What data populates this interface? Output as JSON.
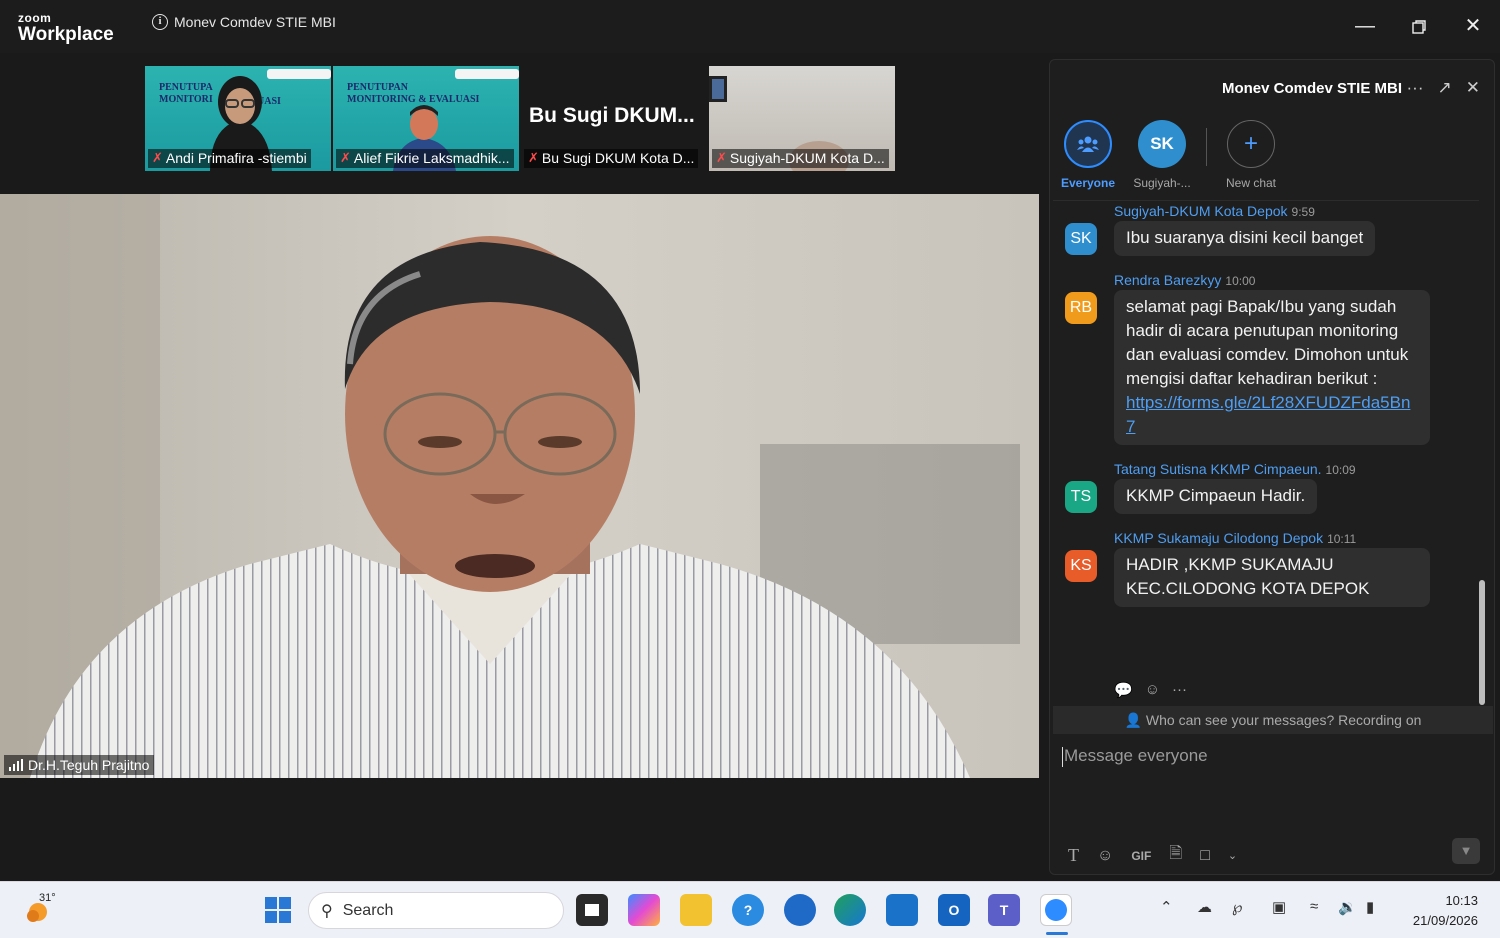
{
  "app": {
    "brand_small": "zoom",
    "brand_big": "Workplace",
    "meeting_title": "Monev Comdev STIE MBI"
  },
  "thumbnails": [
    {
      "name": "Andi Primafira -stiembi",
      "banner_left": "PENUTUPA\nMONITORI",
      "banner_right": "UASI"
    },
    {
      "name": "Alief Fikrie Laksmadhik...",
      "banner_left": "PENUTUPAN\nMONITORING & EVALUASI",
      "banner_right": ""
    },
    {
      "name": "Bu Sugi DKUM Kota D...",
      "big_name": "Bu Sugi DKUM..."
    },
    {
      "name": "Sugiyah-DKUM Kota D..."
    }
  ],
  "speaker": {
    "name": "Dr.H.Teguh Prajitno"
  },
  "chat": {
    "title": "Monev Comdev STIE MBI",
    "recipients": [
      {
        "label": "Everyone",
        "initials": "",
        "active": true
      },
      {
        "label": "Sugiyah-...",
        "initials": "SK"
      },
      {
        "label": "New chat",
        "initials": "+"
      }
    ],
    "messages": [
      {
        "sender": "Sugiyah-DKUM Kota Depok",
        "time": "9:59",
        "initials": "SK",
        "color": "#2f8fce",
        "text": "Ibu suaranya disini kecil banget"
      },
      {
        "sender": "Rendra Barezkyy",
        "time": "10:00",
        "initials": "RB",
        "color": "#f19b1c",
        "text": "selamat pagi Bapak/Ibu yang sudah hadir di acara penutupan monitoring dan evaluasi comdev. Dimohon untuk mengisi daftar kehadiran berikut :",
        "link": "https://forms.gle/2Lf28XFUDZFda5Bn7"
      },
      {
        "sender": "Tatang Sutisna KKMP Cimpaeun.",
        "time": "10:09",
        "initials": "TS",
        "color": "#1aa786",
        "text": "KKMP Cimpaeun Hadir."
      },
      {
        "sender": "KKMP Sukamaju Cilodong Depok",
        "time": "10:11",
        "initials": "KS",
        "color": "#e85c2a",
        "text": "HADIR ,KKMP SUKAMAJU KEC.CILODONG KOTA DEPOK"
      }
    ],
    "notice": "Who can see your messages? Recording on",
    "compose_placeholder": "Message everyone",
    "tool_gif": "GIF"
  },
  "taskbar": {
    "weather": "31°",
    "search_label": "Search",
    "time": "10:13",
    "date": "21/09/2026"
  }
}
